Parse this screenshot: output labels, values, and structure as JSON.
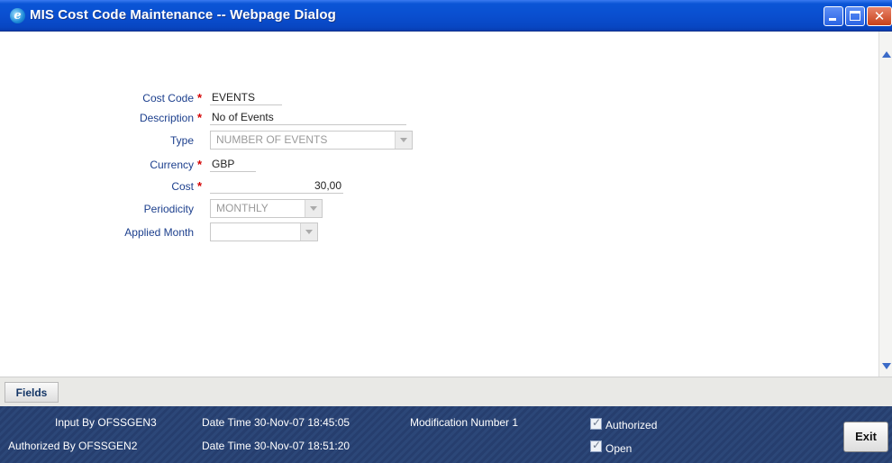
{
  "window": {
    "title": "MIS Cost Code Maintenance -- Webpage Dialog",
    "icon": "ie-icon",
    "controls": {
      "minimize": "minimize-icon",
      "maximize": "maximize-icon",
      "close": "✕"
    }
  },
  "form": {
    "cost_code": {
      "label": "Cost Code",
      "required": "*",
      "value": "EVENTS"
    },
    "description": {
      "label": "Description",
      "required": "*",
      "value": "No of Events"
    },
    "type": {
      "label": "Type",
      "value": "NUMBER OF EVENTS"
    },
    "currency": {
      "label": "Currency",
      "required": "*",
      "value": "GBP"
    },
    "cost": {
      "label": "Cost",
      "required": "*",
      "value": "30,00"
    },
    "periodicity": {
      "label": "Periodicity",
      "value": "MONTHLY"
    },
    "applied_month": {
      "label": "Applied Month",
      "value": ""
    }
  },
  "tabs": [
    {
      "label": "Fields"
    }
  ],
  "footer": {
    "input_by": "Input By OFSSGEN3",
    "authorized_by": "Authorized By OFSSGEN2",
    "input_datetime": "Date Time 30-Nov-07 18:45:05",
    "auth_datetime": "Date Time 30-Nov-07 18:51:20",
    "modification": "Modification Number 1",
    "authorized_label": "Authorized",
    "open_label": "Open",
    "exit_label": "Exit"
  },
  "colors": {
    "title_bar": "#0a4fd0",
    "label_blue": "#1c3f8d",
    "required_red": "#d40000",
    "footer": "#263e6e"
  }
}
